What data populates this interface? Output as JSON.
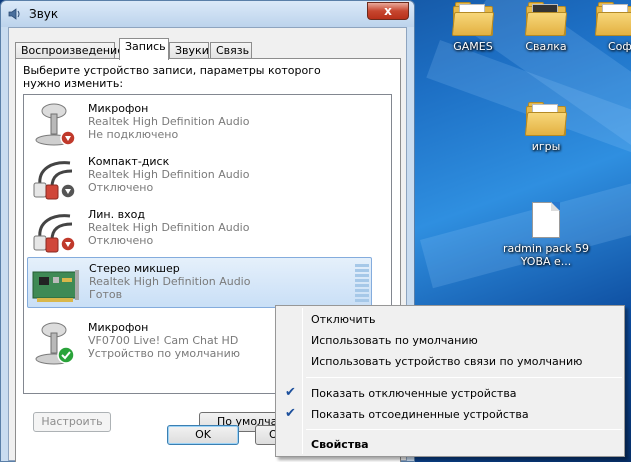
{
  "window": {
    "title": "Звук",
    "close_label": "x",
    "tabs": [
      {
        "label": "Воспроизведение"
      },
      {
        "label": "Запись"
      },
      {
        "label": "Звуки"
      },
      {
        "label": "Связь"
      }
    ],
    "active_tab": "Запись",
    "prompt": "Выберите устройство записи, параметры которого нужно изменить:",
    "devices": [
      {
        "name": "Микрофон",
        "driver": "Realtek High Definition Audio",
        "status": "Не подключено",
        "icon": "microphone-icon",
        "badge": "down-arrow-badge"
      },
      {
        "name": "Компакт-диск",
        "driver": "Realtek High Definition Audio",
        "status": "Отключено",
        "icon": "audio-cable-icon",
        "badge": "down-arrow-badge"
      },
      {
        "name": "Лин. вход",
        "driver": "Realtek High Definition Audio",
        "status": "Отключено",
        "icon": "audio-cable-icon",
        "badge": "down-arrow-badge"
      },
      {
        "name": "Стерео микшер",
        "driver": "Realtek High Definition Audio",
        "status": "Готов",
        "icon": "sound-card-icon",
        "badge": "",
        "selected": true
      },
      {
        "name": "Микрофон",
        "driver": "VF0700 Live! Cam Chat HD",
        "status": "Устройство по умолчанию",
        "icon": "microphone-icon",
        "badge": "default-check-badge"
      }
    ],
    "buttons": {
      "configure": "Настроить",
      "set_default": "По умолчанию",
      "ok": "OK",
      "cancel": "Отмена"
    }
  },
  "context_menu": {
    "items": [
      {
        "label": "Отключить",
        "checked": false,
        "bold": false
      },
      {
        "label": "Использовать по умолчанию",
        "checked": false,
        "bold": false
      },
      {
        "label": "Использовать устройство связи по умолчанию",
        "checked": false,
        "bold": false
      },
      {
        "label": "Показать отключенные устройства",
        "checked": true,
        "bold": false
      },
      {
        "label": "Показать отсоединенные устройства",
        "checked": true,
        "bold": false
      },
      {
        "label": "Свойства",
        "checked": false,
        "bold": true
      }
    ],
    "check_glyph": "✔"
  },
  "desktop": {
    "icons": [
      {
        "label": "GAMES",
        "icon": "folder-icon"
      },
      {
        "label": "Свалка",
        "icon": "folder-icon"
      },
      {
        "label": "Соф",
        "icon": "folder-icon"
      },
      {
        "label": "игры",
        "icon": "folder-icon"
      },
      {
        "label": "radmin pack 59 YOBA e...",
        "icon": "file-icon"
      }
    ]
  }
}
